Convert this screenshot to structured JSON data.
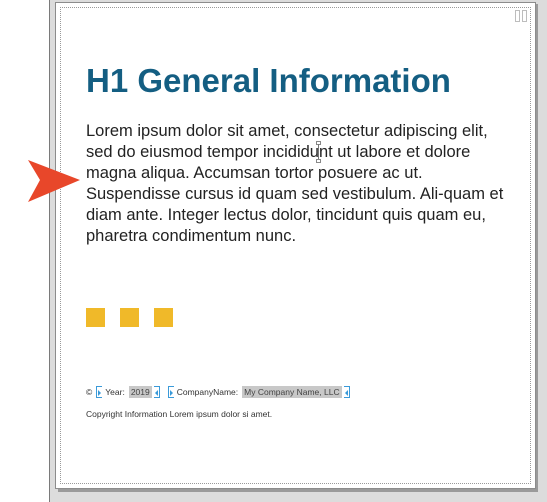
{
  "document": {
    "heading": "H1 General Information",
    "body_text": "Lorem ipsum dolor sit amet, consectetur adipiscing elit, sed do eiusmod tempor incididunt ut labore et dolore magna aliqua. Accumsan tortor posuere ac ut. Suspendisse cursus id quam sed vestibulum. Ali-quam et diam ante. Integer lectus dolor, tincidunt quis quam eu, pharetra condimentum nunc.",
    "decorative_square_color": "#f0b929",
    "heading_color": "#145e82"
  },
  "footer": {
    "copyright_symbol": "©",
    "year_label": "Year:",
    "year_value": "2019",
    "company_label": "CompanyName:",
    "company_value": "My Company Name, LLC",
    "copyright_text": "Copyright Information Lorem ipsum dolor si amet."
  },
  "indicator": {
    "icon": "arrow-right-icon",
    "color": "#e8472a"
  }
}
